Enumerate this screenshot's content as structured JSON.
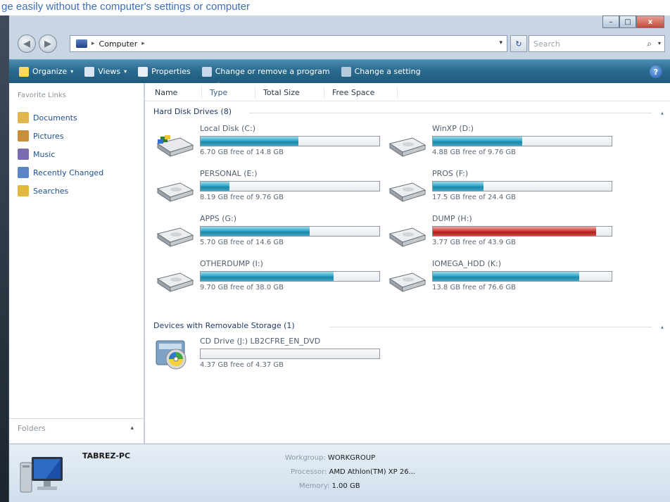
{
  "caption": "ge easily without the computer's settings or computer",
  "window": {
    "title_buttons": {
      "minimize": "–",
      "maximize": "□",
      "close": "x"
    }
  },
  "address_bar": {
    "back_icon": "back-arrow-icon",
    "forward_icon": "forward-arrow-icon",
    "location_icon": "computer-icon",
    "location": "Computer",
    "sep": "▸",
    "trailing_sep": "▸",
    "dropdown": "▾",
    "refresh": "↻",
    "search_placeholder": "Search",
    "search_icon": "search-icon",
    "search_dd": "▾"
  },
  "toolbar": {
    "items": [
      {
        "label": "Organize",
        "icon": "organize-icon",
        "has_arrow": true,
        "color": "#ffd75a"
      },
      {
        "label": "Views",
        "icon": "views-icon",
        "has_arrow": true,
        "color": "#d9e6f2"
      },
      {
        "label": "Properties",
        "icon": "properties-icon",
        "has_arrow": false,
        "color": "#e8eef6"
      },
      {
        "label": "Change or remove a program",
        "icon": "program-icon",
        "has_arrow": false,
        "color": "#c6d8ea"
      },
      {
        "label": "Change a setting",
        "icon": "settings-icon",
        "has_arrow": false,
        "color": "#b5c9dd"
      }
    ],
    "arrow": "▾",
    "help": "?"
  },
  "nav": {
    "heading": "Favorite Links",
    "links": [
      {
        "label": "Documents",
        "icon": "documents-icon",
        "color": "#e3b64c"
      },
      {
        "label": "Pictures",
        "icon": "pictures-icon",
        "color": "#c88e3a"
      },
      {
        "label": "Music",
        "icon": "music-icon",
        "color": "#7d6bb1"
      },
      {
        "label": "Recently Changed",
        "icon": "recently-changed-icon",
        "color": "#5a86c9"
      },
      {
        "label": "Searches",
        "icon": "searches-icon",
        "color": "#e0b93e"
      }
    ],
    "folders": "Folders",
    "folders_chevron": "▴"
  },
  "columns": [
    "Name",
    "Type",
    "Total Size",
    "Free Space"
  ],
  "groups": [
    {
      "title": "Hard Disk Drives (8)",
      "collapse": "▴"
    },
    {
      "title": "Devices with Removable Storage (1)",
      "collapse": "▴"
    }
  ],
  "drives": [
    {
      "name": "Local Disk (C:)",
      "free_text": "6.70 GB free of 14.8 GB",
      "used_fraction": 0.547,
      "status": "normal",
      "icon": "local-disk-icon"
    },
    {
      "name": "WinXP (D:)",
      "free_text": "4.88 GB free of 9.76 GB",
      "used_fraction": 0.5,
      "status": "normal",
      "icon": "hard-disk-icon"
    },
    {
      "name": "PERSONAL (E:)",
      "free_text": "8.19 GB free of 9.76 GB",
      "used_fraction": 0.161,
      "status": "normal",
      "icon": "hard-disk-icon"
    },
    {
      "name": "PROS (F:)",
      "free_text": "17.5 GB free of 24.4 GB",
      "used_fraction": 0.283,
      "status": "normal",
      "icon": "hard-disk-icon"
    },
    {
      "name": "APPS (G:)",
      "free_text": "5.70 GB free of 14.6 GB",
      "used_fraction": 0.61,
      "status": "normal",
      "icon": "hard-disk-icon"
    },
    {
      "name": "DUMP (H:)",
      "free_text": "3.77 GB free of 43.9 GB",
      "used_fraction": 0.914,
      "status": "critical",
      "icon": "hard-disk-icon"
    },
    {
      "name": "OTHERDUMP (I:)",
      "free_text": "9.70 GB free of 38.0 GB",
      "used_fraction": 0.745,
      "status": "normal",
      "icon": "hard-disk-icon"
    },
    {
      "name": "IOMEGA_HDD (K:)",
      "free_text": "13.8 GB free of 76.6 GB",
      "used_fraction": 0.82,
      "status": "normal",
      "icon": "hard-disk-icon"
    }
  ],
  "removable": [
    {
      "name": "CD Drive (J:) LB2CFRE_EN_DVD",
      "free_text": "4.37 GB free of 4.37 GB",
      "used_fraction": 0.0,
      "status": "normal",
      "icon": "cd-drive-icon"
    }
  ],
  "details": {
    "computer_name": "TABREZ-PC",
    "icon": "computer-monitor-icon",
    "props": [
      {
        "label": "Workgroup:",
        "value": "WORKGROUP"
      },
      {
        "label": "Processor:",
        "value": "AMD Athlon(TM) XP 26..."
      },
      {
        "label": "Memory:",
        "value": "1.00 GB"
      }
    ]
  }
}
